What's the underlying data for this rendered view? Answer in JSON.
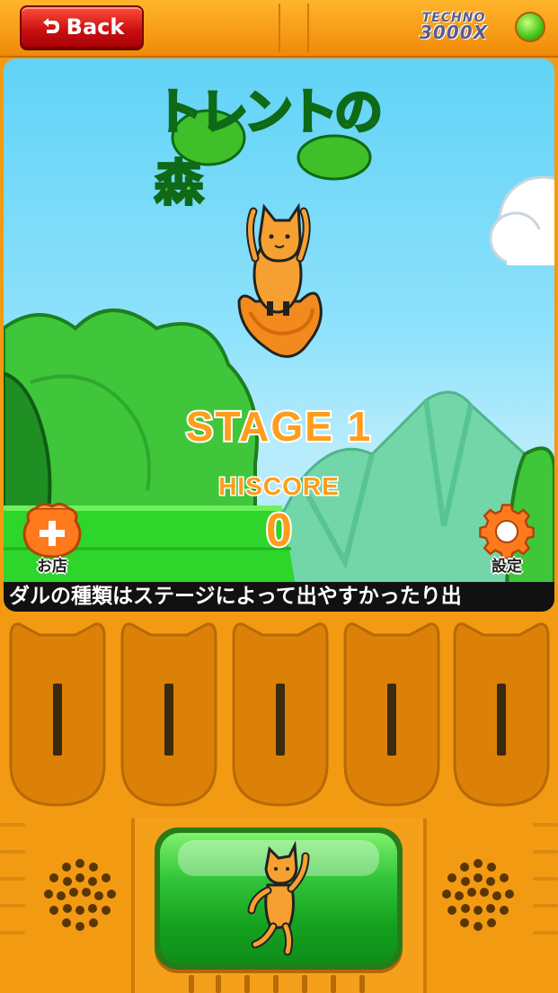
{
  "header": {
    "back_label": "Back",
    "brand_line1": "TECHNO",
    "brand_line2": "3000X",
    "led_color": "#46c21a"
  },
  "game": {
    "logo_text": "トレントの森",
    "stage_label": "STAGE 1",
    "hiscore_label": "HISCORE",
    "hiscore_value": "0"
  },
  "buttons": {
    "shop_label": "お店",
    "shop_icon": "plus-bag-icon",
    "settings_label": "設定",
    "settings_icon": "gear-icon"
  },
  "ticker": {
    "text": "ダルの種類はステージによって出やすかったり出"
  },
  "colors": {
    "body": "#f29a12",
    "sky": "#61d3f7",
    "accent_orange": "#ff9d1c",
    "action_green": "#14a21f",
    "back_red": "#c80f10"
  }
}
